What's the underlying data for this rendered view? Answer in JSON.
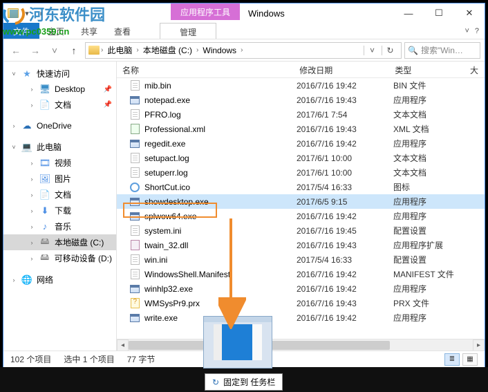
{
  "watermark": {
    "logo_main": "河东软件园",
    "url": "www.pc0359.cn"
  },
  "titlebar": {
    "tool_tab": "应用程序工具",
    "title": "Windows",
    "min": "—",
    "max": "☐",
    "close": "✕"
  },
  "ribbon": {
    "file": "文件",
    "tabs": [
      "主页",
      "共享",
      "查看"
    ],
    "manage": "管理",
    "expand_hint": "˅",
    "help": "?"
  },
  "address": {
    "crumbs": [
      "此电脑",
      "本地磁盘 (C:)",
      "Windows"
    ],
    "search_placeholder": "搜索\"Win…"
  },
  "sidebar": [
    {
      "type": "root",
      "icon": "star",
      "label": "快速访问",
      "expanded": true,
      "children": [
        {
          "icon": "desktop",
          "label": "Desktop",
          "pinned": true
        },
        {
          "icon": "doc",
          "label": "文档",
          "pinned": true
        }
      ]
    },
    {
      "type": "root",
      "icon": "cloud",
      "label": "OneDrive"
    },
    {
      "type": "root",
      "icon": "pc",
      "label": "此电脑",
      "expanded": true,
      "children": [
        {
          "icon": "video",
          "label": "视频"
        },
        {
          "icon": "pic",
          "label": "图片"
        },
        {
          "icon": "doc",
          "label": "文档"
        },
        {
          "icon": "dl",
          "label": "下载"
        },
        {
          "icon": "music",
          "label": "音乐"
        },
        {
          "icon": "drive",
          "label": "本地磁盘 (C:)",
          "selected": true
        },
        {
          "icon": "drive",
          "label": "可移动设备 (D:)"
        }
      ]
    },
    {
      "type": "root",
      "icon": "net",
      "label": "网络"
    }
  ],
  "columns": {
    "name": "名称",
    "date": "修改日期",
    "type": "类型",
    "size": "大"
  },
  "files": [
    {
      "ico": "bin",
      "name": "mib.bin",
      "date": "2016/7/16 19:42",
      "type": "BIN 文件"
    },
    {
      "ico": "exe",
      "name": "notepad.exe",
      "date": "2016/7/16 19:43",
      "type": "应用程序"
    },
    {
      "ico": "log",
      "name": "PFRO.log",
      "date": "2017/6/1 7:54",
      "type": "文本文档"
    },
    {
      "ico": "xml",
      "name": "Professional.xml",
      "date": "2016/7/16 19:43",
      "type": "XML 文档"
    },
    {
      "ico": "exe",
      "name": "regedit.exe",
      "date": "2016/7/16 19:42",
      "type": "应用程序"
    },
    {
      "ico": "log",
      "name": "setupact.log",
      "date": "2017/6/1 10:00",
      "type": "文本文档"
    },
    {
      "ico": "log",
      "name": "setuperr.log",
      "date": "2017/6/1 10:00",
      "type": "文本文档"
    },
    {
      "ico": "ico",
      "name": "ShortCut.ico",
      "date": "2017/5/4 16:33",
      "type": "图标"
    },
    {
      "ico": "exe",
      "name": "showdesktop.exe",
      "date": "2017/6/5 9:15",
      "type": "应用程序",
      "selected": true
    },
    {
      "ico": "exe",
      "name": "splwow64.exe",
      "date": "2016/7/16 19:42",
      "type": "应用程序"
    },
    {
      "ico": "ini",
      "name": "system.ini",
      "date": "2016/7/16 19:45",
      "type": "配置设置"
    },
    {
      "ico": "dll",
      "name": "twain_32.dll",
      "date": "2016/7/16 19:43",
      "type": "应用程序扩展"
    },
    {
      "ico": "ini",
      "name": "win.ini",
      "date": "2017/5/4 16:33",
      "type": "配置设置"
    },
    {
      "ico": "man",
      "name": "WindowsShell.Manifest",
      "date": "2016/7/16 19:42",
      "type": "MANIFEST 文件"
    },
    {
      "ico": "exe",
      "name": "winhlp32.exe",
      "date": "2016/7/16 19:42",
      "type": "应用程序"
    },
    {
      "ico": "prx",
      "name": "WMSysPr9.prx",
      "date": "2016/7/16 19:43",
      "type": "PRX 文件"
    },
    {
      "ico": "exe",
      "name": "write.exe",
      "date": "2016/7/16 19:42",
      "type": "应用程序"
    }
  ],
  "status": {
    "items": "102 个项目",
    "selected": "选中 1 个项目",
    "size": "77 字节"
  },
  "taskbar": {
    "pin_label": "固定到 任务栏"
  }
}
